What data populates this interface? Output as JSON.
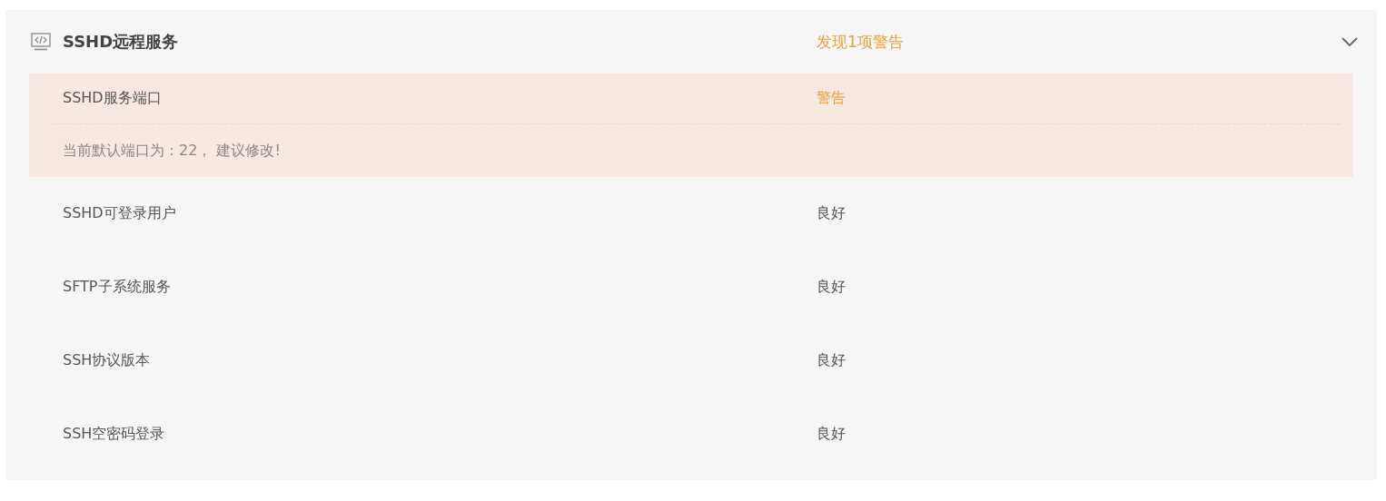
{
  "section": {
    "title": "SSHD远程服务",
    "summary": "发现1项警告",
    "expanded": true,
    "items": [
      {
        "name": "SSHD服务端口",
        "status": "警告",
        "kind": "warning",
        "detail": "当前默认端口为：22， 建议修改!"
      },
      {
        "name": "SSHD可登录用户",
        "status": "良好",
        "kind": "ok"
      },
      {
        "name": "SFTP子系统服务",
        "status": "良好",
        "kind": "ok"
      },
      {
        "name": "SSH协议版本",
        "status": "良好",
        "kind": "ok"
      },
      {
        "name": "SSH空密码登录",
        "status": "良好",
        "kind": "ok"
      }
    ]
  }
}
